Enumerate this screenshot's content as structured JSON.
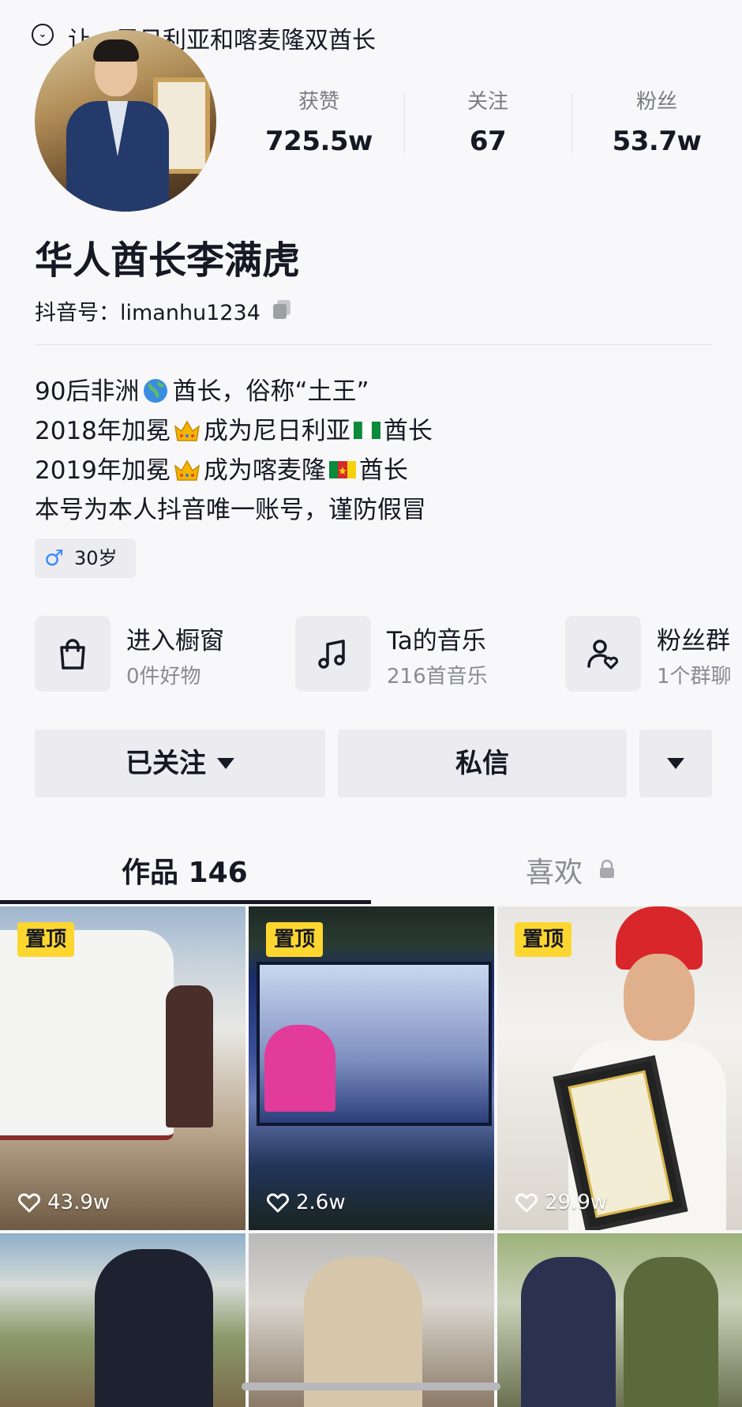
{
  "topbar": {
    "title": "让…尼日利亚和喀麦隆双酋长"
  },
  "stats": [
    {
      "label": "获赞",
      "value": "725.5w"
    },
    {
      "label": "关注",
      "value": "67"
    },
    {
      "label": "粉丝",
      "value": "53.7w"
    }
  ],
  "profile": {
    "name": "华人酋长李满虎",
    "id_line": "抖音号：limanhu1234",
    "bio": [
      {
        "pre": "90后非洲",
        "emoji": "globe",
        "post": "酋长，俗称“土王”"
      },
      {
        "pre": "2018年加冕",
        "emoji": "crown",
        "mid": "成为尼日利亚",
        "emoji2": "nigeria-flag",
        "post": "酋长"
      },
      {
        "pre": "2019年加冕",
        "emoji": "crown",
        "mid": "成为喀麦隆",
        "emoji2": "cameroon-flag",
        "post": "酋长"
      },
      {
        "pre": "本号为本人抖音唯一账号，谨防假冒"
      }
    ],
    "age": "30岁",
    "gender_icon": "male-icon"
  },
  "shortcuts": [
    {
      "title": "进入橱窗",
      "sub": "0件好物",
      "icon": "shopping-bag-icon"
    },
    {
      "title": "Ta的音乐",
      "sub": "216首音乐",
      "icon": "music-note-icon"
    },
    {
      "title": "粉丝群",
      "sub": "1个群聊",
      "icon": "fan-group-icon"
    }
  ],
  "actions": {
    "follow": "已关注",
    "message": "私信"
  },
  "tabs": {
    "works": "作品 146",
    "likes": "喜欢"
  },
  "videos": [
    {
      "pinned": "置顶",
      "likes": "43.9w"
    },
    {
      "pinned": "置顶",
      "likes": "2.6w"
    },
    {
      "pinned": "置顶",
      "likes": "29.9w"
    },
    {
      "pinned": "",
      "likes": ""
    },
    {
      "pinned": "",
      "likes": ""
    },
    {
      "pinned": "",
      "likes": ""
    }
  ],
  "colors": {
    "pin": "#fdd630",
    "text": "#161823",
    "muted": "#8a8b91",
    "background": "#f8f8fa"
  }
}
